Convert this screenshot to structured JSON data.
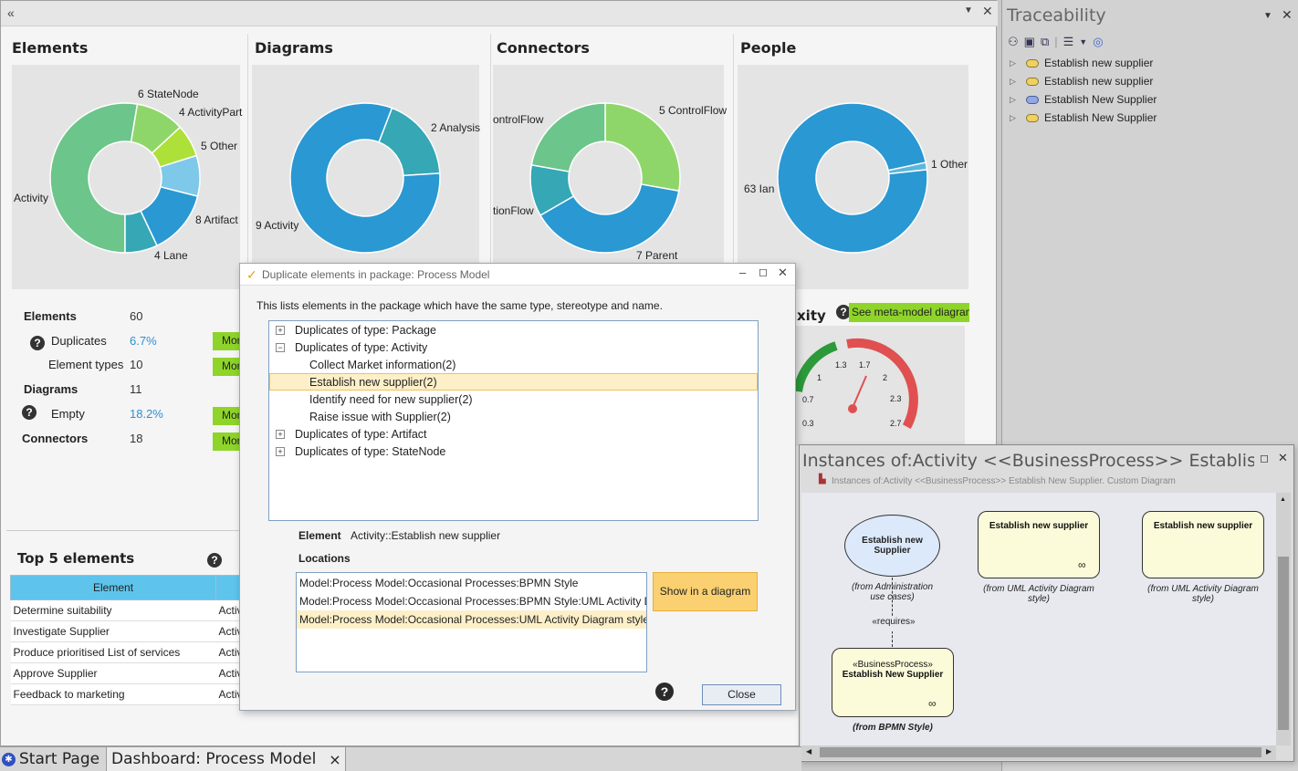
{
  "dashboard": {
    "panels": [
      {
        "title": "Elements",
        "chart": "elements"
      },
      {
        "title": "Diagrams",
        "chart": "diagrams"
      },
      {
        "title": "Connectors",
        "chart": "connectors"
      },
      {
        "title": "People",
        "chart": "people"
      }
    ],
    "stats": {
      "elements_label": "Elements",
      "elements_value": "60",
      "duplicates_label": "Duplicates",
      "duplicates_value": "6.7%",
      "element_types_label": "Element types",
      "element_types_value": "10",
      "diagrams_label": "Diagrams",
      "diagrams_value": "11",
      "empty_label": "Empty",
      "empty_value": "18.2%",
      "connectors_label": "Connectors",
      "connectors_value": "18",
      "more_label": "Mor"
    },
    "complexity_partial": "xity",
    "meta_model_button": "See meta-model diagram",
    "gauge_ticks": [
      "1",
      "1.3",
      "1.7",
      "2",
      "0.7",
      "2.3",
      "0.3",
      "2.7"
    ],
    "top5": {
      "title": "Top 5 elements",
      "header_element": "Element",
      "rows": [
        {
          "element": "Determine suitability",
          "type": "Activ"
        },
        {
          "element": "Investigate Supplier",
          "type": "Activ"
        },
        {
          "element": "Produce prioritised List of services",
          "type": "Activ"
        },
        {
          "element": "Approve Supplier",
          "type": "Activ"
        },
        {
          "element": "Feedback to marketing",
          "type": "Activ"
        }
      ]
    }
  },
  "chart_data": [
    {
      "type": "pie",
      "title": "Elements",
      "slices": [
        {
          "label": "Activity",
          "value": 30
        },
        {
          "label": "StateNode",
          "value": 6
        },
        {
          "label": "ActivityPart",
          "value": 4
        },
        {
          "label": "Other",
          "value": 5
        },
        {
          "label": "Artifact",
          "value": 8
        },
        {
          "label": "Lane",
          "value": 4
        }
      ],
      "colors": [
        "#6cc58a",
        "#8fd66a",
        "#aee03a",
        "#7ec8ea",
        "#2a98d2",
        "#35a7b5"
      ]
    },
    {
      "type": "pie",
      "title": "Diagrams",
      "slices": [
        {
          "label": "Analysis",
          "value": 2
        },
        {
          "label": "Activity",
          "value": 9
        }
      ],
      "colors": [
        "#35a7b5",
        "#2a98d2"
      ]
    },
    {
      "type": "pie",
      "title": "Connectors",
      "slices": [
        {
          "label": "ControlFlow",
          "value": 5
        },
        {
          "label": "Parent",
          "value": 7
        },
        {
          "label": "InformationFlow",
          "value": 2
        },
        {
          "label": "ControlFlow",
          "value": 4
        }
      ],
      "colors": [
        "#8fd66a",
        "#2a98d2",
        "#35a7b5",
        "#6cc58a"
      ]
    },
    {
      "type": "pie",
      "title": "People",
      "slices": [
        {
          "label": "Other",
          "value": 1
        },
        {
          "label": "Ian",
          "value": 63
        }
      ],
      "colors": [
        "#5eb6dc",
        "#2a98d2"
      ]
    }
  ],
  "chart_labels": {
    "e_statenode": "6 StateNode",
    "e_activitypart": "4 ActivityPart",
    "e_other": "5 Other",
    "e_artifact": "8 Artifact",
    "e_lane": "4 Lane",
    "e_activity": "Activity",
    "d_analysis": "2 Analysis",
    "d_activity": "9 Activity",
    "c_controlflow_left": "ontrolFlow",
    "c_controlflow": "5 ControlFlow",
    "c_infoflow": "tionFlow",
    "c_parent": "7 Parent",
    "p_other": "1 Other",
    "p_ian": "63 Ian"
  },
  "traceability": {
    "title": "Traceability",
    "items": [
      {
        "label": "Establish new supplier",
        "color": "#f0d060"
      },
      {
        "label": "Establish new supplier",
        "color": "#f0d060"
      },
      {
        "label": "Establish New Supplier",
        "color": "#90a8e8"
      },
      {
        "label": "Establish New Supplier",
        "color": "#f0d060"
      }
    ]
  },
  "dialog": {
    "title": "Duplicate elements in package: Process Model",
    "description": "This lists elements in the package which have the same type, stereotype and name.",
    "tree": [
      {
        "label": "Duplicates of type: Package",
        "expander": "+",
        "level": 0
      },
      {
        "label": "Duplicates of type: Activity",
        "expander": "−",
        "level": 0
      },
      {
        "label": "Collect Market information(2)",
        "expander": "",
        "level": 1
      },
      {
        "label": "Establish new supplier(2)",
        "expander": "",
        "level": 1,
        "selected": true
      },
      {
        "label": "Identify need for new supplier(2)",
        "expander": "",
        "level": 1
      },
      {
        "label": "Raise issue with Supplier(2)",
        "expander": "",
        "level": 1
      },
      {
        "label": "Duplicates of type: Artifact",
        "expander": "+",
        "level": 0
      },
      {
        "label": "Duplicates of type: StateNode",
        "expander": "+",
        "level": 0
      }
    ],
    "element_label": "Element",
    "element_value": "Activity::Establish new supplier",
    "locations_label": "Locations",
    "locations": [
      "Model:Process Model:Occasional Processes:BPMN Style",
      "Model:Process Model:Occasional Processes:BPMN Style:UML Activity Diagr",
      "Model:Process Model:Occasional Processes:UML Activity Diagram style"
    ],
    "show_button": "Show in a diagram",
    "close_button": "Close"
  },
  "instances": {
    "title": "Instances of:Activity <<BusinessProcess>> Establish New...",
    "subtitle": "Instances of:Activity <<BusinessProcess>> Establish New Supplier.  Custom Diagram",
    "usecase_label": "Establish new Supplier",
    "usecase_note": "(from Administration use cases)",
    "activity1_label": "Establish new supplier",
    "activity1_note": "(from UML Activity Diagram style)",
    "activity2_label": "Establish new supplier",
    "activity2_note": "(from UML Activity Diagram style)",
    "requires_label": "«requires»",
    "bp_stereotype": "«BusinessProcess»",
    "bp_label": "Establish New Supplier",
    "bp_note": "(from BPMN Style)"
  },
  "tabs": {
    "start_page": "Start Page",
    "dashboard": "Dashboard: Process Model",
    "close_glyph": "×"
  }
}
